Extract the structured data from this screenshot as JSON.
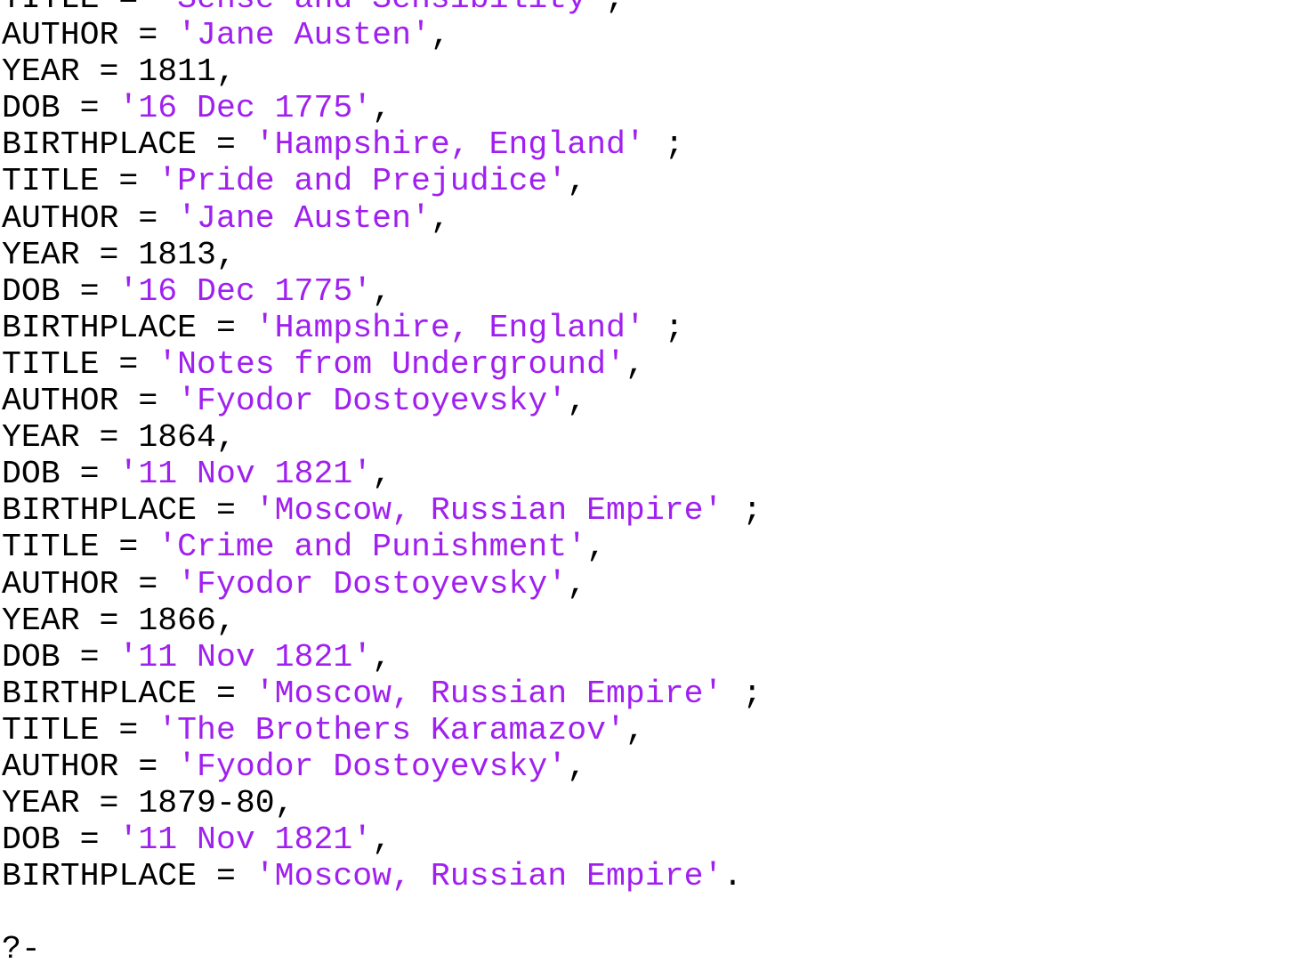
{
  "colors": {
    "text": "#000000",
    "string": "#a020f0",
    "background": "#ffffff"
  },
  "records": [
    {
      "title": "'Sense and Sensibility'",
      "author": "'Jane Austen'",
      "year": "1811",
      "dob": "'16 Dec 1775'",
      "birthplace": "'Hampshire, England'",
      "end": " ;"
    },
    {
      "title": "'Pride and Prejudice'",
      "author": "'Jane Austen'",
      "year": "1813",
      "dob": "'16 Dec 1775'",
      "birthplace": "'Hampshire, England'",
      "end": " ;"
    },
    {
      "title": "'Notes from Underground'",
      "author": "'Fyodor Dostoyevsky'",
      "year": "1864",
      "dob": "'11 Nov 1821'",
      "birthplace": "'Moscow, Russian Empire'",
      "end": " ;"
    },
    {
      "title": "'Crime and Punishment'",
      "author": "'Fyodor Dostoyevsky'",
      "year": "1866",
      "dob": "'11 Nov 1821'",
      "birthplace": "'Moscow, Russian Empire'",
      "end": " ;"
    },
    {
      "title": "'The Brothers Karamazov'",
      "author": "'Fyodor Dostoyevsky'",
      "year": "1879-80",
      "dob": "'11 Nov 1821'",
      "birthplace": "'Moscow, Russian Empire'",
      "end": "."
    }
  ],
  "labels": {
    "title": "TITLE = ",
    "author": "AUTHOR = ",
    "year": "YEAR = ",
    "dob": "DOB = ",
    "birthplace": "BIRTHPLACE = ",
    "comma": ","
  },
  "prompt": "?-"
}
